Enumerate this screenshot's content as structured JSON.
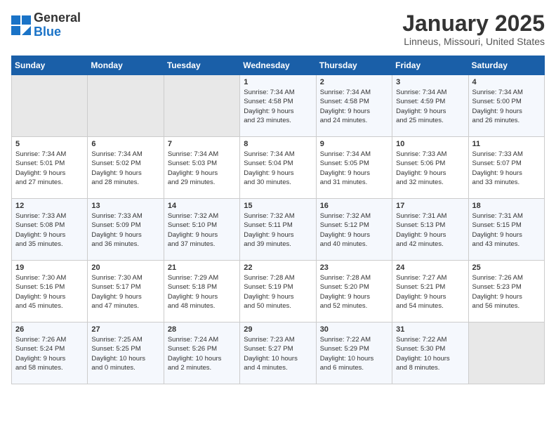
{
  "header": {
    "logo_line1": "General",
    "logo_line2": "Blue",
    "month": "January 2025",
    "location": "Linneus, Missouri, United States"
  },
  "days_of_week": [
    "Sunday",
    "Monday",
    "Tuesday",
    "Wednesday",
    "Thursday",
    "Friday",
    "Saturday"
  ],
  "weeks": [
    [
      {
        "day": "",
        "info": ""
      },
      {
        "day": "",
        "info": ""
      },
      {
        "day": "",
        "info": ""
      },
      {
        "day": "1",
        "info": "Sunrise: 7:34 AM\nSunset: 4:58 PM\nDaylight: 9 hours\nand 23 minutes."
      },
      {
        "day": "2",
        "info": "Sunrise: 7:34 AM\nSunset: 4:58 PM\nDaylight: 9 hours\nand 24 minutes."
      },
      {
        "day": "3",
        "info": "Sunrise: 7:34 AM\nSunset: 4:59 PM\nDaylight: 9 hours\nand 25 minutes."
      },
      {
        "day": "4",
        "info": "Sunrise: 7:34 AM\nSunset: 5:00 PM\nDaylight: 9 hours\nand 26 minutes."
      }
    ],
    [
      {
        "day": "5",
        "info": "Sunrise: 7:34 AM\nSunset: 5:01 PM\nDaylight: 9 hours\nand 27 minutes."
      },
      {
        "day": "6",
        "info": "Sunrise: 7:34 AM\nSunset: 5:02 PM\nDaylight: 9 hours\nand 28 minutes."
      },
      {
        "day": "7",
        "info": "Sunrise: 7:34 AM\nSunset: 5:03 PM\nDaylight: 9 hours\nand 29 minutes."
      },
      {
        "day": "8",
        "info": "Sunrise: 7:34 AM\nSunset: 5:04 PM\nDaylight: 9 hours\nand 30 minutes."
      },
      {
        "day": "9",
        "info": "Sunrise: 7:34 AM\nSunset: 5:05 PM\nDaylight: 9 hours\nand 31 minutes."
      },
      {
        "day": "10",
        "info": "Sunrise: 7:33 AM\nSunset: 5:06 PM\nDaylight: 9 hours\nand 32 minutes."
      },
      {
        "day": "11",
        "info": "Sunrise: 7:33 AM\nSunset: 5:07 PM\nDaylight: 9 hours\nand 33 minutes."
      }
    ],
    [
      {
        "day": "12",
        "info": "Sunrise: 7:33 AM\nSunset: 5:08 PM\nDaylight: 9 hours\nand 35 minutes."
      },
      {
        "day": "13",
        "info": "Sunrise: 7:33 AM\nSunset: 5:09 PM\nDaylight: 9 hours\nand 36 minutes."
      },
      {
        "day": "14",
        "info": "Sunrise: 7:32 AM\nSunset: 5:10 PM\nDaylight: 9 hours\nand 37 minutes."
      },
      {
        "day": "15",
        "info": "Sunrise: 7:32 AM\nSunset: 5:11 PM\nDaylight: 9 hours\nand 39 minutes."
      },
      {
        "day": "16",
        "info": "Sunrise: 7:32 AM\nSunset: 5:12 PM\nDaylight: 9 hours\nand 40 minutes."
      },
      {
        "day": "17",
        "info": "Sunrise: 7:31 AM\nSunset: 5:13 PM\nDaylight: 9 hours\nand 42 minutes."
      },
      {
        "day": "18",
        "info": "Sunrise: 7:31 AM\nSunset: 5:15 PM\nDaylight: 9 hours\nand 43 minutes."
      }
    ],
    [
      {
        "day": "19",
        "info": "Sunrise: 7:30 AM\nSunset: 5:16 PM\nDaylight: 9 hours\nand 45 minutes."
      },
      {
        "day": "20",
        "info": "Sunrise: 7:30 AM\nSunset: 5:17 PM\nDaylight: 9 hours\nand 47 minutes."
      },
      {
        "day": "21",
        "info": "Sunrise: 7:29 AM\nSunset: 5:18 PM\nDaylight: 9 hours\nand 48 minutes."
      },
      {
        "day": "22",
        "info": "Sunrise: 7:28 AM\nSunset: 5:19 PM\nDaylight: 9 hours\nand 50 minutes."
      },
      {
        "day": "23",
        "info": "Sunrise: 7:28 AM\nSunset: 5:20 PM\nDaylight: 9 hours\nand 52 minutes."
      },
      {
        "day": "24",
        "info": "Sunrise: 7:27 AM\nSunset: 5:21 PM\nDaylight: 9 hours\nand 54 minutes."
      },
      {
        "day": "25",
        "info": "Sunrise: 7:26 AM\nSunset: 5:23 PM\nDaylight: 9 hours\nand 56 minutes."
      }
    ],
    [
      {
        "day": "26",
        "info": "Sunrise: 7:26 AM\nSunset: 5:24 PM\nDaylight: 9 hours\nand 58 minutes."
      },
      {
        "day": "27",
        "info": "Sunrise: 7:25 AM\nSunset: 5:25 PM\nDaylight: 10 hours\nand 0 minutes."
      },
      {
        "day": "28",
        "info": "Sunrise: 7:24 AM\nSunset: 5:26 PM\nDaylight: 10 hours\nand 2 minutes."
      },
      {
        "day": "29",
        "info": "Sunrise: 7:23 AM\nSunset: 5:27 PM\nDaylight: 10 hours\nand 4 minutes."
      },
      {
        "day": "30",
        "info": "Sunrise: 7:22 AM\nSunset: 5:29 PM\nDaylight: 10 hours\nand 6 minutes."
      },
      {
        "day": "31",
        "info": "Sunrise: 7:22 AM\nSunset: 5:30 PM\nDaylight: 10 hours\nand 8 minutes."
      },
      {
        "day": "",
        "info": ""
      }
    ]
  ]
}
